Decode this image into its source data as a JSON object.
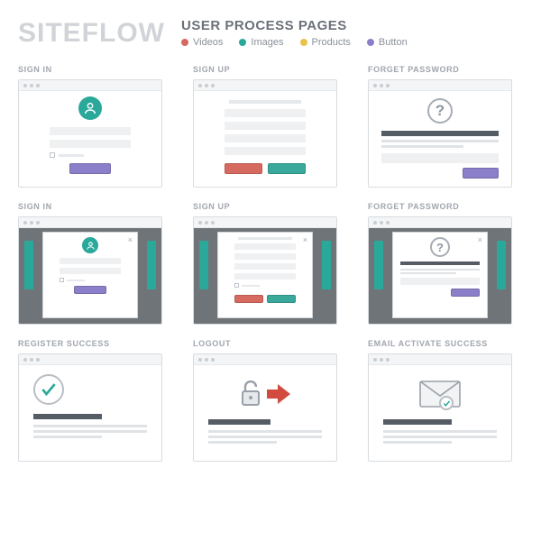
{
  "header": {
    "logo": "SITEFLOW",
    "subtitle": "USER PROCESS PAGES",
    "legend": [
      {
        "label": "Videos",
        "color": "#d76a60"
      },
      {
        "label": "Images",
        "color": "#2aa89a"
      },
      {
        "label": "Products",
        "color": "#e8c24b"
      },
      {
        "label": "Button",
        "color": "#8b7fc9"
      }
    ]
  },
  "cards": {
    "sign_in_label": "SIGN IN",
    "sign_up_label": "SIGN UP",
    "forget_pw_label": "FORGET PASSWORD",
    "register_success_label": "REGISTER SUCCESS",
    "logout_label": "LOGOUT",
    "email_activate_label": "EMAIL ACTIVATE SUCCESS"
  },
  "icons": {
    "question_mark": "?",
    "close_x": "×"
  },
  "colors": {
    "teal": "#2aa89a",
    "purple": "#8b7fc9",
    "red": "#d76a60",
    "yellow": "#e8c24b",
    "grey_dark": "#565c64"
  }
}
